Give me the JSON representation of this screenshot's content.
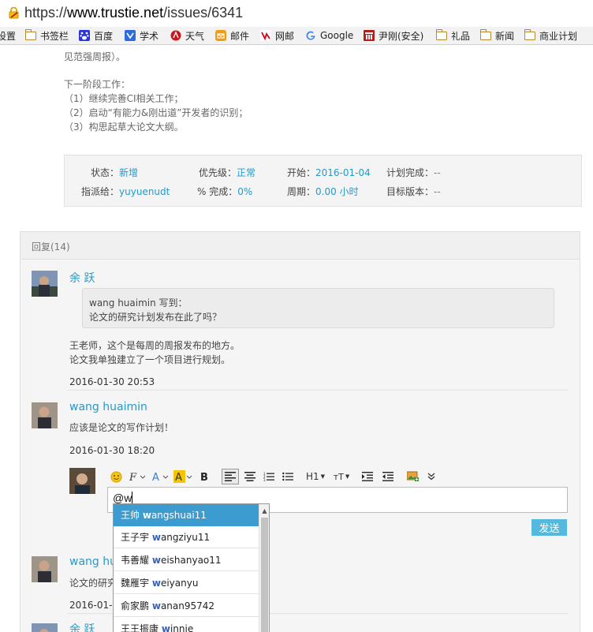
{
  "browser": {
    "url_scheme": "https://",
    "url_host": "www.trustie.net",
    "url_path": "/issues/6341",
    "bookmarks": [
      {
        "label": "设置",
        "icon": "none"
      },
      {
        "label": "书签栏",
        "icon": "folder-icon"
      },
      {
        "label": "百度",
        "icon": "baidu-paw-icon"
      },
      {
        "label": "学术",
        "icon": "xueshu-icon"
      },
      {
        "label": "天气",
        "icon": "weather-icon"
      },
      {
        "label": "邮件",
        "icon": "mail-icon"
      },
      {
        "label": "网邮",
        "icon": "netease-mail-icon"
      },
      {
        "label": "Google",
        "icon": "google-icon"
      },
      {
        "label": "尹刚(安全)",
        "icon": "security-icon"
      },
      {
        "label": "礼品",
        "icon": "folder-icon"
      },
      {
        "label": "新闻",
        "icon": "folder-icon"
      },
      {
        "label": "商业计划",
        "icon": "folder-icon"
      }
    ]
  },
  "issue": {
    "desc_lines": [
      "见范强周报）。",
      "下一阶段工作：",
      "（1）继续完善CI相关工作；",
      "（2）启动“有能力&刚出道”开发者的识别；",
      "（3）构思起草大论文大纲。"
    ],
    "attributes": {
      "status_label": "状态：",
      "status_value": "新增",
      "priority_label": "优先级：",
      "priority_value": "正常",
      "start_label": "开始：",
      "start_value": "2016-01-04",
      "plan_done_label": "计划完成：",
      "plan_done_value": "--",
      "assignee_label": "指派给：",
      "assignee_value": "yuyuenudt",
      "percent_label": "% 完成：",
      "percent_value": "0%",
      "period_label": "周期：",
      "period_value": "0.00 小时",
      "target_label": "目标版本：",
      "target_value": "--"
    }
  },
  "replies": {
    "title": "回复(14)",
    "reply1": {
      "author": "余 跃",
      "quote_header": "wang huaimin 写到：",
      "quote_text": "论文的研究计划发布在此了吗？",
      "body_line1": "王老师，这个是每周的周报发布的地方。",
      "body_line2": "论文我单独建立了一个项目进行规划。",
      "time": "2016-01-30 20:53"
    },
    "reply2": {
      "author": "wang huaimin",
      "body": "应该是论文的写作计划！",
      "time": "2016-01-30 18:20"
    },
    "reply3": {
      "author_partial": "wang hu",
      "body_partial": "论文的研究",
      "time_partial": "2016-01-3"
    },
    "reply4": {
      "author_partial": "余 跃"
    }
  },
  "editor": {
    "input_value": "@w",
    "send_label": "发送",
    "toolbar": {
      "heading_label": "H1",
      "fontsize_label": "тT"
    },
    "mentions": [
      {
        "name": "王帅",
        "hl": "w",
        "rest": "angshuai11",
        "selected": true
      },
      {
        "name": "王子宇",
        "hl": "w",
        "rest": "angziyu11",
        "selected": false
      },
      {
        "name": "韦善耀",
        "hl": "w",
        "rest": "eishanyao11",
        "selected": false
      },
      {
        "name": "魏雁宇",
        "hl": "w",
        "rest": "eiyanyu",
        "selected": false
      },
      {
        "name": "俞家鹏",
        "hl": "w",
        "rest": "anan95742",
        "selected": false
      },
      {
        "name": "王王振康",
        "hl": "w",
        "rest": "innie",
        "selected": false
      }
    ]
  },
  "colors": {
    "link": "#269ac9",
    "selected_row": "#3c9ccf",
    "send_button": "#55b8dd"
  }
}
